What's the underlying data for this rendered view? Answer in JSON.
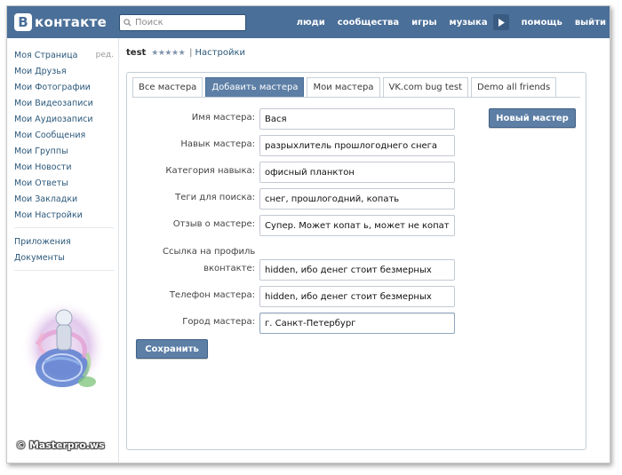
{
  "header": {
    "logo_letter": "В",
    "logo_text": "контакте",
    "search_placeholder": "Поиск",
    "nav": [
      "люди",
      "сообщества",
      "игры",
      "музыка",
      "помощь",
      "выйти"
    ]
  },
  "sidebar": {
    "items": [
      {
        "label": "Моя Страница",
        "edit": "ред."
      },
      {
        "label": "Мои Друзья"
      },
      {
        "label": "Мои Фотографии"
      },
      {
        "label": "Мои Видеозаписи"
      },
      {
        "label": "Мои Аудиозаписи"
      },
      {
        "label": "Мои Сообщения"
      },
      {
        "label": "Мои Группы"
      },
      {
        "label": "Мои Новости"
      },
      {
        "label": "Мои Ответы"
      },
      {
        "label": "Мои Закладки"
      },
      {
        "label": "Мои Настройки"
      }
    ],
    "extra": [
      "Приложения",
      "Документы"
    ],
    "watermark": "© Masterpro.ws"
  },
  "breadcrumb": {
    "title": "test",
    "stars": "★★★★★",
    "separator": "|",
    "settings": "Настройки"
  },
  "tabs": [
    {
      "label": "Все мастера",
      "active": false
    },
    {
      "label": "Добавить мастера",
      "active": true
    },
    {
      "label": "Мои мастера",
      "active": false
    },
    {
      "label": "VK.com bug test",
      "active": false
    },
    {
      "label": "Demo all friends",
      "active": false
    }
  ],
  "form": {
    "fields": [
      {
        "label": "Имя мастера:",
        "value": "Вася"
      },
      {
        "label": "Навык мастера:",
        "value": "разрыхлитель прошлогоднего снега"
      },
      {
        "label": "Категория навыка:",
        "value": "офисный планктон"
      },
      {
        "label": "Теги для поиска:",
        "value": "снег, прошлогодний, копать"
      },
      {
        "label": "Отзыв о мастере:",
        "value": "Супер. Может копат ь, может не копать..."
      }
    ],
    "profile_section": "Ссылка на профиль",
    "fields2": [
      {
        "label": "вконтакте:",
        "value": "hidden, ибо денег стоит безмерных"
      },
      {
        "label": "Телефон мастера:",
        "value": "hidden, ибо денег стоит безмерных"
      },
      {
        "label": "Город мастера:",
        "value": "г. Санкт-Петербург"
      }
    ],
    "new_button": "Новый мастер",
    "save_button": "Сохранить"
  }
}
